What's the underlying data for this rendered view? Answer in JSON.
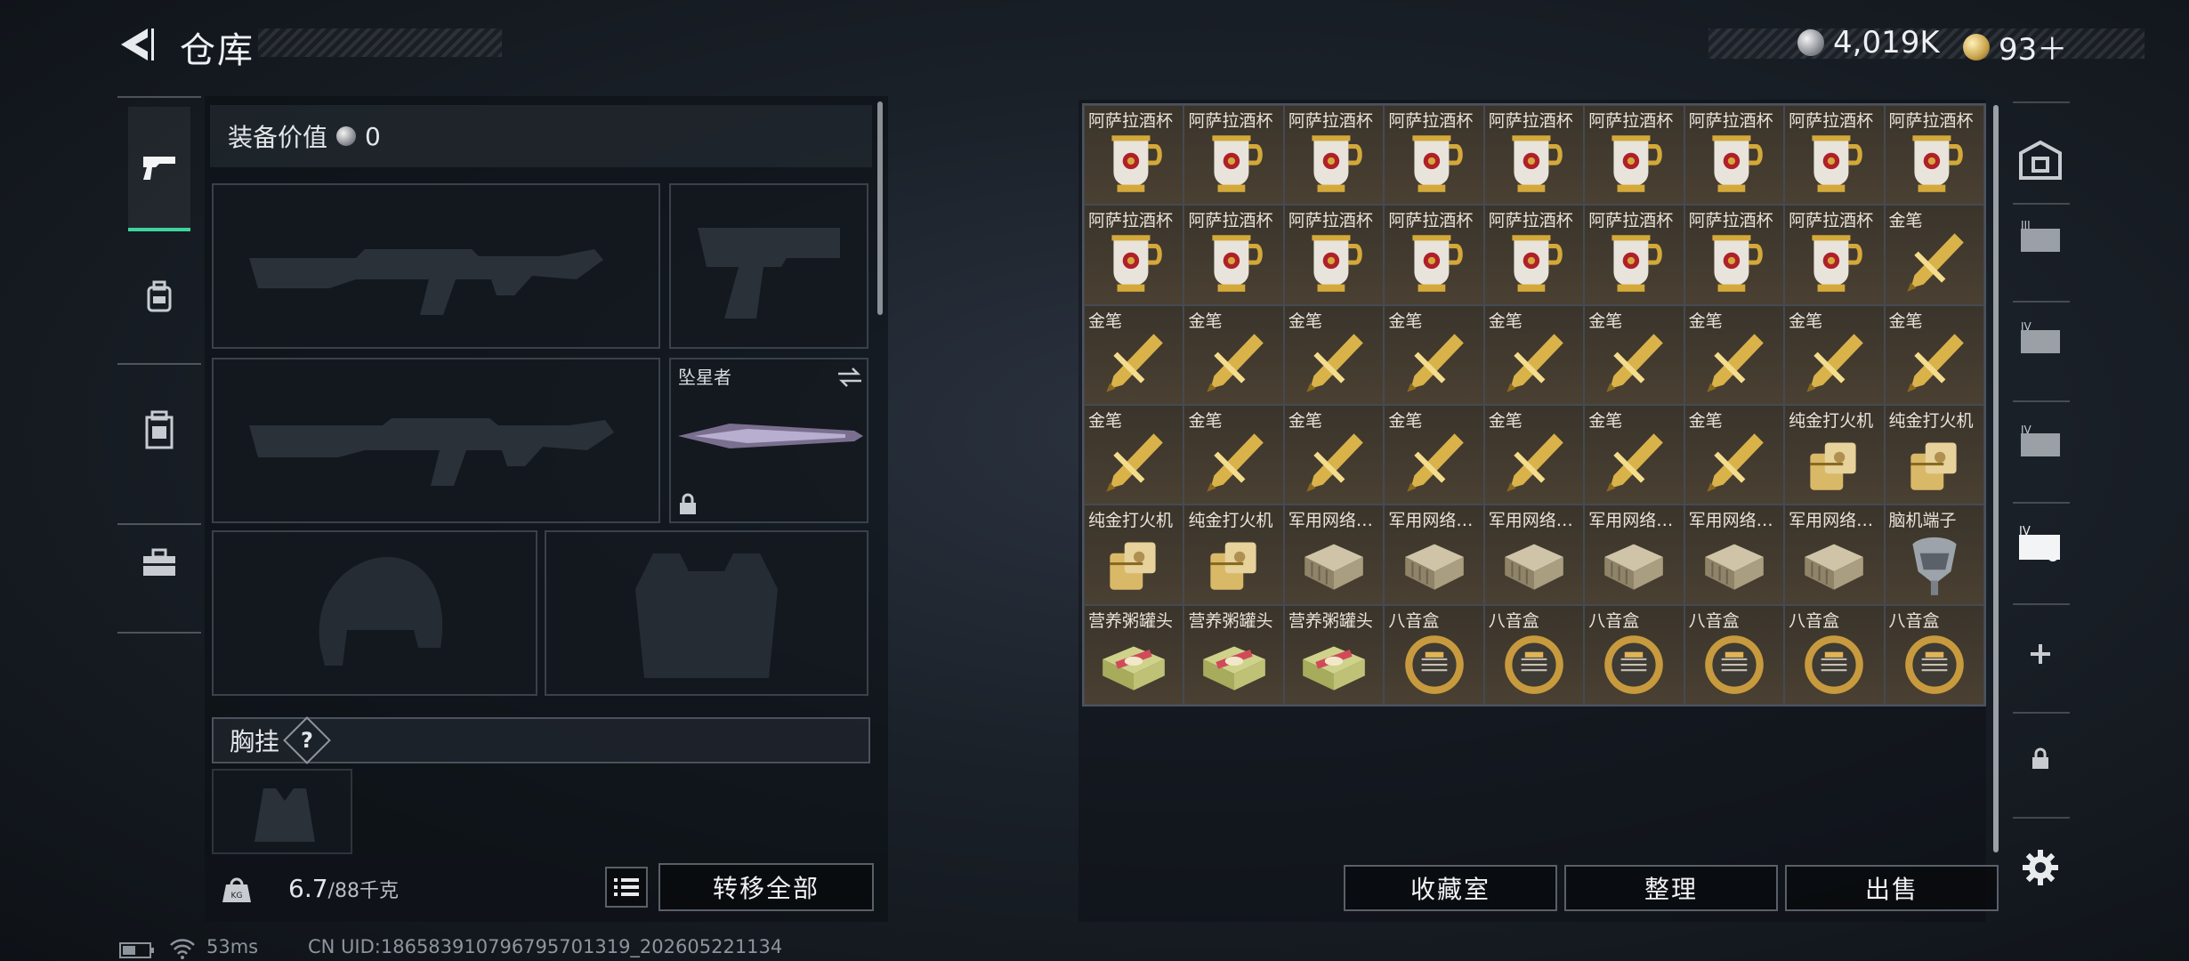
{
  "header": {
    "title": "仓库"
  },
  "currency": {
    "silver": "4,019K",
    "gold": "93＋"
  },
  "equipment": {
    "value_label": "装备价值",
    "value": "0",
    "melee_slot_name": "坠星者",
    "chest_label": "胸挂",
    "help": "?"
  },
  "footer": {
    "weight": "6.7",
    "capacity": "/88千克",
    "transfer_all": "转移全部"
  },
  "storage_grid": [
    [
      "阿萨拉酒杯",
      "阿萨拉酒杯",
      "阿萨拉酒杯",
      "阿萨拉酒杯",
      "阿萨拉酒杯",
      "阿萨拉酒杯",
      "阿萨拉酒杯",
      "阿萨拉酒杯",
      "阿萨拉酒杯"
    ],
    [
      "阿萨拉酒杯",
      "阿萨拉酒杯",
      "阿萨拉酒杯",
      "阿萨拉酒杯",
      "阿萨拉酒杯",
      "阿萨拉酒杯",
      "阿萨拉酒杯",
      "阿萨拉酒杯",
      "金笔"
    ],
    [
      "金笔",
      "金笔",
      "金笔",
      "金笔",
      "金笔",
      "金笔",
      "金笔",
      "金笔",
      "金笔"
    ],
    [
      "金笔",
      "金笔",
      "金笔",
      "金笔",
      "金笔",
      "金笔",
      "金笔",
      "纯金打火机",
      "纯金打火机"
    ],
    [
      "纯金打火机",
      "纯金打火机",
      "军用网络…",
      "军用网络…",
      "军用网络…",
      "军用网络…",
      "军用网络…",
      "军用网络…",
      "脑机端子"
    ],
    [
      "营养粥罐头",
      "营养粥罐头",
      "营养粥罐头",
      "八音盒",
      "八音盒",
      "八音盒",
      "八音盒",
      "八音盒",
      "八音盒"
    ]
  ],
  "actions": {
    "collection": "收藏室",
    "sort": "整理",
    "sell": "出售"
  },
  "status_bar": {
    "ping": "53ms",
    "uid": "CN UID:18658391079679570131​9_202605221134"
  }
}
